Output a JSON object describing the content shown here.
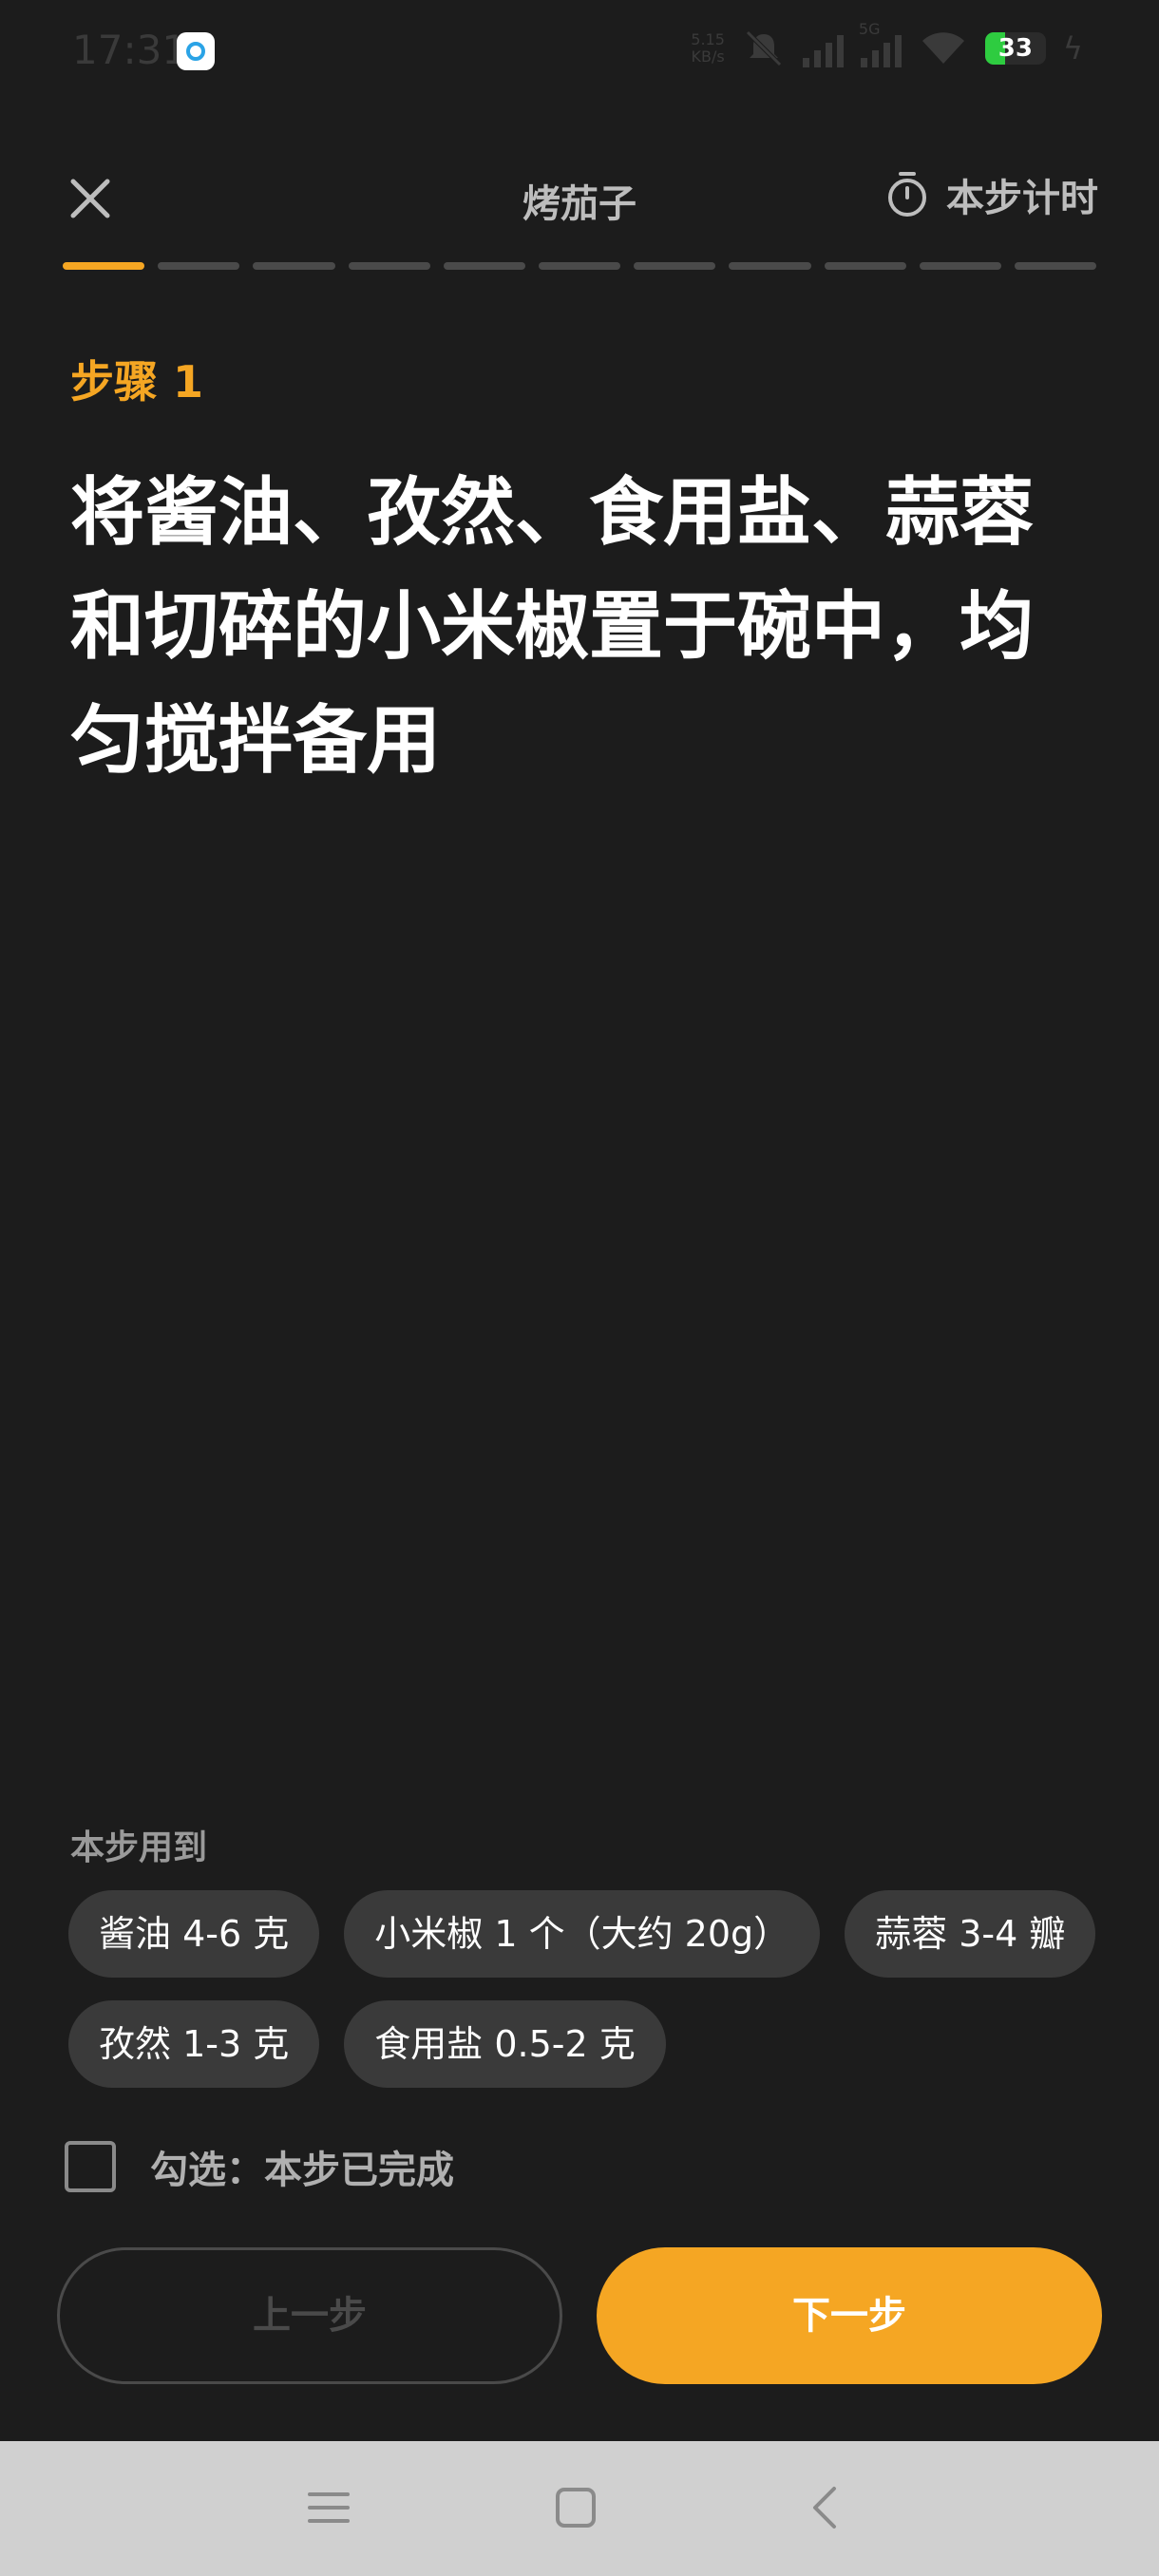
{
  "status_bar": {
    "time": "17:31",
    "net_speed_value": "5.15",
    "net_speed_unit": "KB/s",
    "network_type": "5G",
    "battery": "33",
    "battery_level_percent": 33
  },
  "header": {
    "title": "烤茄子",
    "timer_label": "本步计时"
  },
  "progress": {
    "total_steps": 11,
    "current_step": 1
  },
  "step": {
    "label": "步骤 1",
    "text": "将酱油、孜然、食用盐、蒜蓉和切碎的小米椒置于碗中，均匀搅拌备用"
  },
  "ingredients": {
    "label": "本步用到",
    "items": [
      "酱油 4-6 克",
      "小米椒 1 个（大约 20g）",
      "蒜蓉 3-4 瓣",
      "孜然 1-3 克",
      "食用盐 0.5-2 克"
    ]
  },
  "done_checkbox": {
    "label": "勾选：本步已完成",
    "checked": false
  },
  "buttons": {
    "prev": "上一步",
    "next": "下一步"
  },
  "colors": {
    "accent": "#f5a623",
    "background": "#1c1c1c",
    "chip": "#3a3a3a"
  },
  "icons": {
    "close": "close-icon",
    "timer": "stopwatch-icon",
    "nav_menu": "menu-icon",
    "nav_home": "home-square-icon",
    "nav_back": "back-chevron-icon"
  }
}
